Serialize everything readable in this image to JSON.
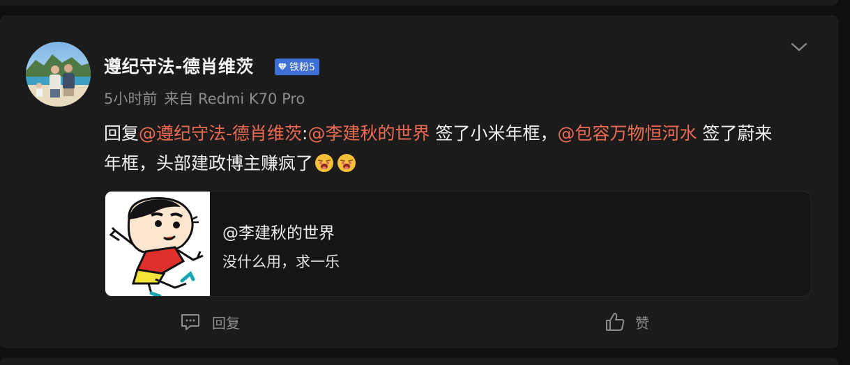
{
  "post": {
    "username": "遵纪守法-德肖维茨",
    "badge": "铁粉5",
    "time": "5小时前",
    "from_label": "来自 Redmi K70 Pro",
    "content": {
      "prefix": "回复",
      "mention1": "@遵纪守法-德肖维茨",
      "colon": ":",
      "mention2": "@李建秋的世界",
      "text1": " 签了小米年框，",
      "mention3": "@包容万物恒河水",
      "text2": " 签了蔚来年框，头部建政博主赚疯了"
    },
    "quote": {
      "author": "@李建秋的世界",
      "text": "没什么用，求一乐"
    },
    "actions": {
      "reply_label": "回复",
      "like_label": "赞"
    }
  },
  "colors": {
    "background": "#0f0f0f",
    "card": "#1b1b1b",
    "mention": "#ee6a52",
    "badge": "#3d6fd6",
    "muted": "#8c8c8c"
  },
  "icons": [
    "chevron-down-icon",
    "reply-comment-icon",
    "thumbs-up-icon",
    "diamond-icon",
    "face-emoji-icon"
  ]
}
